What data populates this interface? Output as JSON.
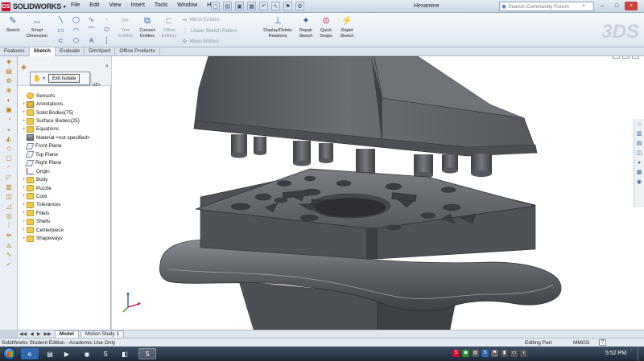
{
  "app": {
    "logo_badge": "DS",
    "logo_text": "SOLIDWORKS",
    "menu": [
      "File",
      "Edit",
      "View",
      "Insert",
      "Tools",
      "Window",
      "Help"
    ],
    "document_title": "Hexamine",
    "search_placeholder": "Search Community Forum",
    "window_buttons": [
      "–",
      "□",
      "×"
    ]
  },
  "ribbon": {
    "buttons": {
      "sketch": "Sketch",
      "smart_dimension": "Smart Dimension",
      "trim_entities": "Trim Entities",
      "convert_entities": "Convert Entities",
      "offset_entities": "Offset Entities",
      "display_delete_relations": "Display/Delete Relations",
      "repair_sketch": "Repair Sketch",
      "quick_snaps": "Quick Snaps",
      "rapid_sketch": "Rapid Sketch"
    },
    "small_commands": {
      "mirror": "Mirror Entities",
      "linear_pattern": "Linear Sketch Pattern",
      "move": "Move Entities"
    },
    "brand_mark": "3DS"
  },
  "tabs": [
    {
      "label": "Features",
      "active": false
    },
    {
      "label": "Sketch",
      "active": true
    },
    {
      "label": "Evaluate",
      "active": false
    },
    {
      "label": "DimXpert",
      "active": false
    },
    {
      "label": "Office Products",
      "active": false
    }
  ],
  "isolate_popup": {
    "button_label": "Exit Isolate"
  },
  "tree_header_fragment": "ult>",
  "tree": [
    {
      "label": "Sensors",
      "icon": "sensor",
      "expander": ""
    },
    {
      "label": "Annotations",
      "icon": "annot",
      "expander": "+"
    },
    {
      "label": "Solid Bodies(75)",
      "icon": "folder",
      "expander": "+"
    },
    {
      "label": "Surface Bodies(25)",
      "icon": "folder",
      "expander": "+"
    },
    {
      "label": "Equations",
      "icon": "eq",
      "expander": "+"
    },
    {
      "label": "Material <not specified>",
      "icon": "mat",
      "expander": ""
    },
    {
      "label": "Front Plane",
      "icon": "plane",
      "expander": ""
    },
    {
      "label": "Top Plane",
      "icon": "plane",
      "expander": ""
    },
    {
      "label": "Right Plane",
      "icon": "plane",
      "expander": ""
    },
    {
      "label": "Origin",
      "icon": "origin",
      "expander": ""
    },
    {
      "label": "Body",
      "icon": "folder",
      "expander": "+"
    },
    {
      "label": "Puzzle",
      "icon": "folder",
      "expander": "+"
    },
    {
      "label": "Core",
      "icon": "folder",
      "expander": "+"
    },
    {
      "label": "Tolerances",
      "icon": "folder",
      "expander": "+"
    },
    {
      "label": "Fillets",
      "icon": "folder",
      "expander": "+"
    },
    {
      "label": "Shells",
      "icon": "folder",
      "expander": "+"
    },
    {
      "label": "Centerpiece",
      "icon": "folder",
      "expander": "+"
    },
    {
      "label": "Shapeways",
      "icon": "folder",
      "expander": "+"
    }
  ],
  "bottom_tabs": [
    {
      "label": "Model",
      "active": true
    },
    {
      "label": "Motion Study 1",
      "active": false
    }
  ],
  "status": {
    "left": "SolidWorks Student Edition - Academic Use Only",
    "mode": "Editing Part",
    "units": "MMGS",
    "help": "?"
  },
  "taskbar": {
    "clock": "5:52 PM"
  },
  "colors": {
    "model_fill": "#5e6166",
    "model_dark": "#3f4246",
    "model_light": "#7b7e83",
    "ribbon_accent": "#2f5d9b",
    "folder": "#f2c94c"
  }
}
